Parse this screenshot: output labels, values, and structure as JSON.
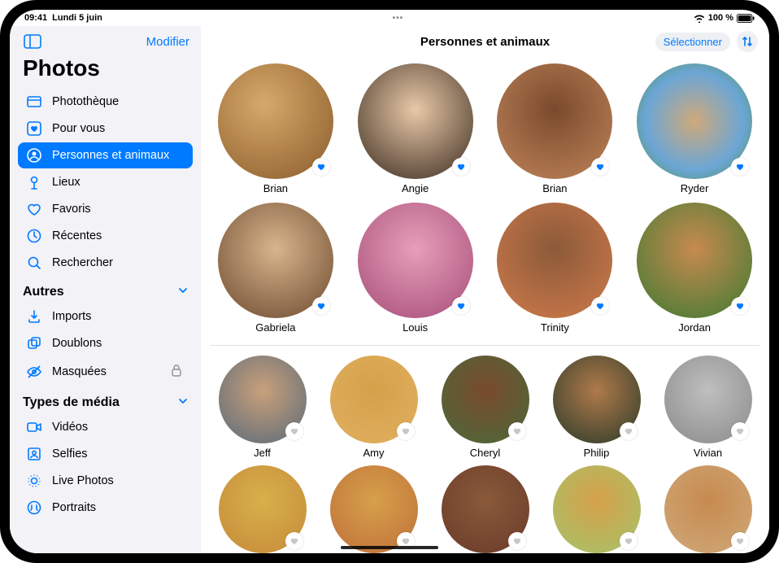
{
  "status": {
    "time": "09:41",
    "date": "Lundi 5 juin",
    "battery_text": "100 %"
  },
  "sidebar": {
    "modify_label": "Modifier",
    "app_title": "Photos",
    "items": [
      {
        "label": "Photothèque",
        "icon": "library"
      },
      {
        "label": "Pour vous",
        "icon": "heart-square"
      },
      {
        "label": "Personnes et animaux",
        "icon": "person-circle",
        "active": true
      },
      {
        "label": "Lieux",
        "icon": "pin"
      },
      {
        "label": "Favoris",
        "icon": "heart"
      },
      {
        "label": "Récentes",
        "icon": "clock"
      },
      {
        "label": "Rechercher",
        "icon": "search"
      }
    ],
    "section_others": {
      "title": "Autres",
      "items": [
        {
          "label": "Imports",
          "icon": "import"
        },
        {
          "label": "Doublons",
          "icon": "duplicates"
        },
        {
          "label": "Masquées",
          "icon": "eye-slash",
          "locked": true
        }
      ]
    },
    "section_media": {
      "title": "Types de média",
      "items": [
        {
          "label": "Vidéos",
          "icon": "video"
        },
        {
          "label": "Selfies",
          "icon": "selfie"
        },
        {
          "label": "Live Photos",
          "icon": "livephoto"
        },
        {
          "label": "Portraits",
          "icon": "portrait"
        }
      ]
    }
  },
  "main": {
    "title": "Personnes et animaux",
    "select_label": "Sélectionner",
    "favorites": [
      {
        "name": "Brian",
        "fav": true,
        "color": "c0"
      },
      {
        "name": "Angie",
        "fav": true,
        "color": "c1"
      },
      {
        "name": "Brian",
        "fav": true,
        "color": "c2"
      },
      {
        "name": "Ryder",
        "fav": true,
        "color": "c3"
      },
      {
        "name": "Gabriela",
        "fav": true,
        "color": "c4"
      },
      {
        "name": "Louis",
        "fav": true,
        "color": "c5"
      },
      {
        "name": "Trinity",
        "fav": true,
        "color": "c6"
      },
      {
        "name": "Jordan",
        "fav": true,
        "color": "c7"
      }
    ],
    "others": [
      {
        "name": "Jeff",
        "fav": false,
        "color": "c8"
      },
      {
        "name": "Amy",
        "fav": false,
        "color": "c9"
      },
      {
        "name": "Cheryl",
        "fav": false,
        "color": "c10"
      },
      {
        "name": "Philip",
        "fav": false,
        "color": "c11"
      },
      {
        "name": "Vivian",
        "fav": false,
        "color": "c12"
      },
      {
        "name": "",
        "fav": false,
        "color": "c13"
      },
      {
        "name": "",
        "fav": false,
        "color": "c14"
      },
      {
        "name": "",
        "fav": false,
        "color": "c15"
      },
      {
        "name": "",
        "fav": false,
        "color": "c16"
      },
      {
        "name": "",
        "fav": false,
        "color": "c17"
      }
    ]
  }
}
